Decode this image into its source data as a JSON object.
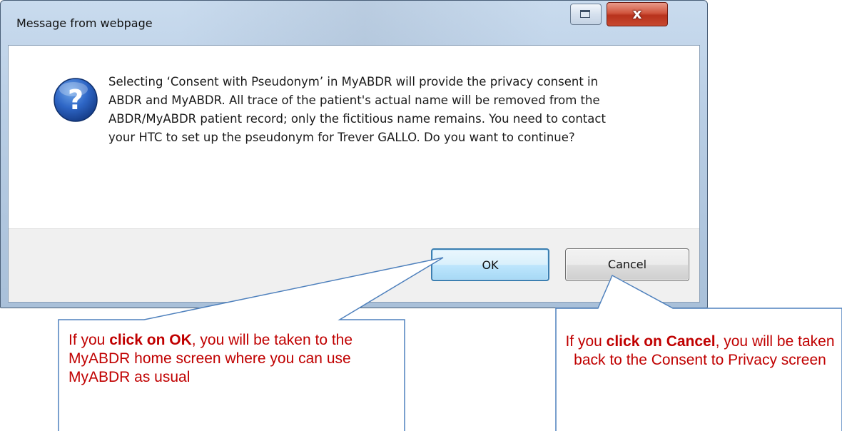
{
  "dialog": {
    "title": "Message from webpage",
    "close_glyph": "x",
    "icon": "help-question-icon",
    "message": "Selecting ‘Consent with Pseudonym’ in MyABDR will provide the privacy consent in ABDR and MyABDR. All trace of the patient's actual name will be removed from the ABDR/MyABDR patient record; only the fictitious name remains. You need to contact your HTC to set up the pseudonym for Trever GALLO. Do you want to continue?",
    "ok_label": "OK",
    "cancel_label": "Cancel"
  },
  "callouts": {
    "ok": {
      "prefix": "If you ",
      "bold": "click on OK",
      "suffix": ", you will be taken to the MyABDR home screen where you can use MyABDR as usual"
    },
    "cancel": {
      "prefix": "If you ",
      "bold": "click on Cancel",
      "suffix": ", you will be taken back to the Consent to Privacy screen"
    }
  },
  "colors": {
    "callout_text": "#c00000",
    "callout_border": "#4f81bd",
    "close_button": "#c7482f",
    "ok_border": "#3c7fb1"
  }
}
